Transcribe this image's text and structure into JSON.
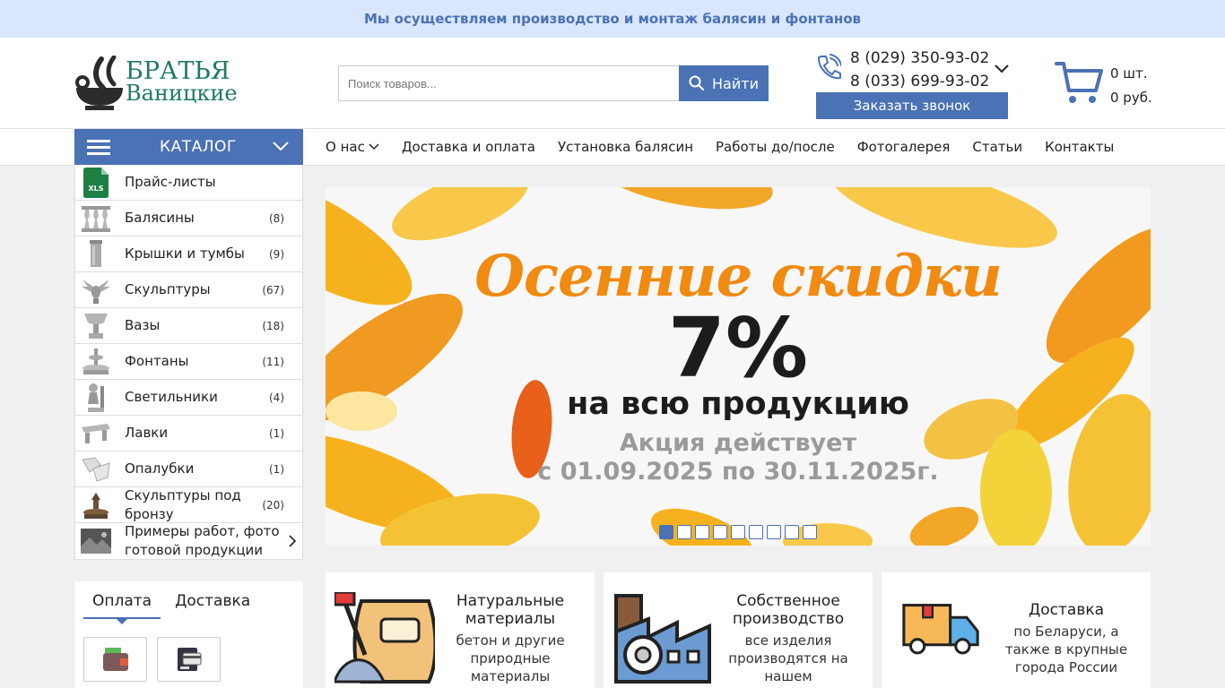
{
  "topbar": {
    "text": "Мы осуществляем производство и монтаж балясин и фонтанов"
  },
  "logo": {
    "line1": "БРАТЬЯ",
    "line2": "Ваницкие"
  },
  "search": {
    "placeholder": "Поиск товаров...",
    "button_label": "Найти"
  },
  "contacts": {
    "phone1": "8 (029) 350-93-02",
    "phone2": "8 (033) 699-93-02",
    "callback_label": "Заказать звонок"
  },
  "cart": {
    "count": "0 шт.",
    "total": "0 руб."
  },
  "catalog": {
    "label": "КАТАЛОГ"
  },
  "menu": {
    "items": [
      {
        "label": "О нас"
      },
      {
        "label": "Доставка и оплата"
      },
      {
        "label": "Установка балясин"
      },
      {
        "label": "Работы до/после"
      },
      {
        "label": "Фотогалерея"
      },
      {
        "label": "Статьи"
      },
      {
        "label": "Контакты"
      }
    ]
  },
  "sidebar": {
    "items": [
      {
        "label": "Прайс-листы",
        "count": "",
        "icon": "xls-file-icon"
      },
      {
        "label": "Балясины",
        "count": "(8)",
        "icon": "baluster-icon"
      },
      {
        "label": "Крышки и тумбы",
        "count": "(9)",
        "icon": "pillar-icon"
      },
      {
        "label": "Скульптуры",
        "count": "(67)",
        "icon": "sculpture-icon"
      },
      {
        "label": "Вазы",
        "count": "(18)",
        "icon": "vase-icon"
      },
      {
        "label": "Фонтаны",
        "count": "(11)",
        "icon": "fountain-icon"
      },
      {
        "label": "Светильники",
        "count": "(4)",
        "icon": "lamp-icon"
      },
      {
        "label": "Лавки",
        "count": "(1)",
        "icon": "bench-icon"
      },
      {
        "label": "Опалубки",
        "count": "(1)",
        "icon": "formwork-icon"
      },
      {
        "label": "Скульптуры под бронзу",
        "count": "(20)",
        "icon": "bronze-sculpture-icon"
      },
      {
        "label": "Примеры работ, фото готовой продукции",
        "count": "",
        "icon": "works-photo-icon"
      }
    ]
  },
  "banner": {
    "title": "Осенние скидки",
    "percent": "7%",
    "subtitle": "на всю продукцию",
    "promo_line1": "Акция действует",
    "promo_line2": "с 01.09.2025 по 30.11.2025г.",
    "slides_total": 9,
    "active_slide": 1
  },
  "payment": {
    "tabs": [
      {
        "label": "Оплата"
      },
      {
        "label": "Доставка"
      }
    ],
    "active_tab": 0
  },
  "features": [
    {
      "title": "Натуральные материалы",
      "desc": "бетон и другие природные материалы",
      "icon": "cement-bag-icon"
    },
    {
      "title": "Собственное производство",
      "desc": "все изделия производятся на нашем предприятии",
      "icon": "factory-icon"
    },
    {
      "title": "Доставка",
      "desc": "по Беларуси, а также в крупные города России",
      "icon": "delivery-truck-icon"
    }
  ],
  "colors": {
    "brand_blue": "#4a72b4",
    "brand_green": "#1d7a66",
    "topbar_bg": "#d9e6fb",
    "banner_orange": "#f08a10"
  }
}
